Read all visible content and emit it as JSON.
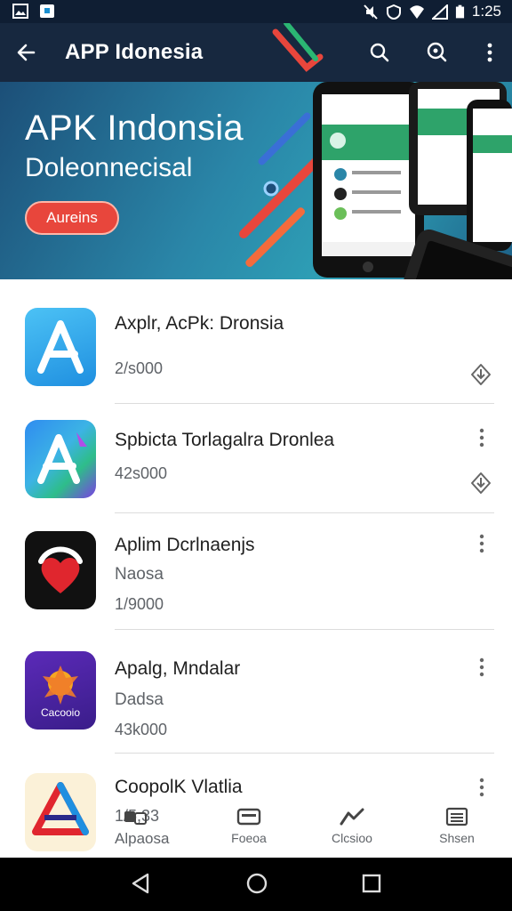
{
  "status_bar": {
    "time": "1:25"
  },
  "app_bar": {
    "title": "APP Idonesia"
  },
  "banner": {
    "title": "APK Indonsia",
    "subtitle": "Doleonnecisal",
    "cta_label": "Aureins"
  },
  "apps": [
    {
      "name": "Axplr, AcPk: Dronsia",
      "subtitle": "",
      "meta": "2/s000",
      "action_icon": "download-icon"
    },
    {
      "name": "Spbicta Torlagalra Dronlea",
      "subtitle": "",
      "meta": "42s000",
      "action_icon": "download-icon"
    },
    {
      "name": "Aplim Dcrlnaenjs",
      "subtitle": "Naosa",
      "meta": "1/9000",
      "action_icon": "more-vert-icon"
    },
    {
      "name": "Apalg, Mndalar",
      "subtitle": "Dadsa",
      "meta": "43k000",
      "action_icon": "more-vert-icon",
      "icon_text": "Cacooio"
    },
    {
      "name": "CoopolK Vlatlia",
      "subtitle": "Alpaosa",
      "meta": "1/5,33",
      "action_icon": "more-vert-icon"
    }
  ],
  "bottom_nav": [
    {
      "label": "",
      "icon": "apps-icon"
    },
    {
      "label": "Foeoa",
      "icon": "cards-icon"
    },
    {
      "label": "Clcsioo",
      "icon": "trending-icon"
    },
    {
      "label": "Shsen",
      "icon": "list-icon"
    }
  ],
  "colors": {
    "app_bar": "#17283f",
    "status_bar": "#0f1e33",
    "accent_red": "#e8463c",
    "banner_teal": "#2a86a8"
  }
}
